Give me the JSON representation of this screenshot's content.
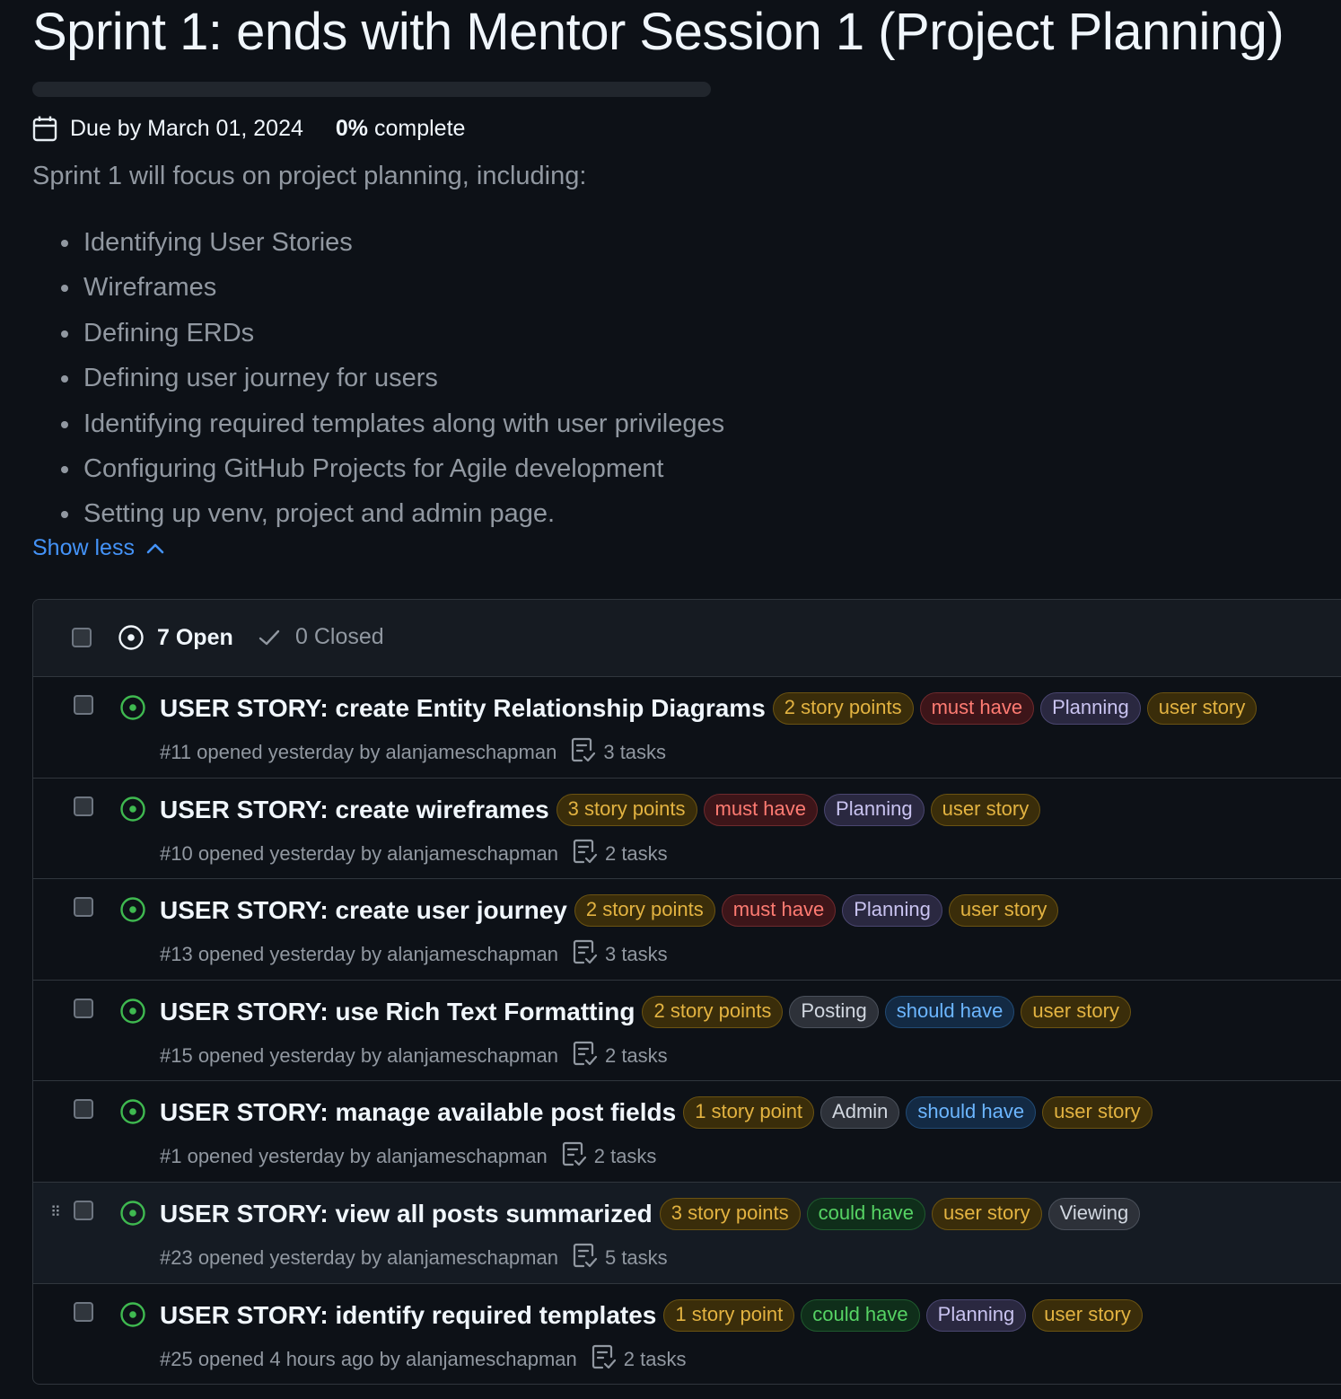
{
  "milestone": {
    "title": "Sprint 1: ends with Mentor Session 1 (Project Planning)",
    "progress_percent": 0,
    "due": "Due by March 01, 2024",
    "complete_value": "0%",
    "complete_label": "complete",
    "description": "Sprint 1 will focus on project planning, including:",
    "bullets": [
      "Identifying User Stories",
      "Wireframes",
      "Defining ERDs",
      "Defining user journey for users",
      "Identifying required templates along with user privileges",
      "Configuring GitHub Projects for Agile development",
      "Setting up venv, project and admin page."
    ],
    "show_less": "Show less"
  },
  "tabs": {
    "open": "7 Open",
    "closed": "0 Closed"
  },
  "label_colors": {
    "yellow": {
      "fg": "#e3b341",
      "bg": "#3a2d0a",
      "border": "#6b5312"
    },
    "red": {
      "fg": "#ff7b72",
      "bg": "#3d1519",
      "border": "#6e2a2d"
    },
    "purple": {
      "fg": "#c9c3f0",
      "bg": "#2a2840",
      "border": "#4a4670"
    },
    "gray": {
      "fg": "#d1d7e0",
      "bg": "#2d3139",
      "border": "#4a505a"
    },
    "blue": {
      "fg": "#6cb6ff",
      "bg": "#132a44",
      "border": "#214a74"
    },
    "green": {
      "fg": "#56d364",
      "bg": "#0f2e1a",
      "border": "#1f5a2e"
    }
  },
  "issues": [
    {
      "title": "USER STORY: create Entity Relationship Diagrams",
      "labels": [
        {
          "text": "2 story points",
          "color": "yellow"
        },
        {
          "text": "must have",
          "color": "red"
        },
        {
          "text": "Planning",
          "color": "purple"
        },
        {
          "text": "user story",
          "color": "yellow"
        }
      ],
      "meta": "#11 opened yesterday by alanjameschapman",
      "tasks": "3 tasks"
    },
    {
      "title": "USER STORY: create wireframes",
      "labels": [
        {
          "text": "3 story points",
          "color": "yellow"
        },
        {
          "text": "must have",
          "color": "red"
        },
        {
          "text": "Planning",
          "color": "purple"
        },
        {
          "text": "user story",
          "color": "yellow"
        }
      ],
      "meta": "#10 opened yesterday by alanjameschapman",
      "tasks": "2 tasks"
    },
    {
      "title": "USER STORY: create user journey",
      "labels": [
        {
          "text": "2 story points",
          "color": "yellow"
        },
        {
          "text": "must have",
          "color": "red"
        },
        {
          "text": "Planning",
          "color": "purple"
        },
        {
          "text": "user story",
          "color": "yellow"
        }
      ],
      "meta": "#13 opened yesterday by alanjameschapman",
      "tasks": "3 tasks"
    },
    {
      "title": "USER STORY: use Rich Text Formatting",
      "labels": [
        {
          "text": "2 story points",
          "color": "yellow"
        },
        {
          "text": "Posting",
          "color": "gray"
        },
        {
          "text": "should have",
          "color": "blue"
        },
        {
          "text": "user story",
          "color": "yellow"
        }
      ],
      "meta": "#15 opened yesterday by alanjameschapman",
      "tasks": "2 tasks"
    },
    {
      "title": "USER STORY: manage available post fields",
      "labels": [
        {
          "text": "1 story point",
          "color": "yellow"
        },
        {
          "text": "Admin",
          "color": "gray"
        },
        {
          "text": "should have",
          "color": "blue"
        },
        {
          "text": "user story",
          "color": "yellow"
        }
      ],
      "meta": "#1 opened yesterday by alanjameschapman",
      "tasks": "2 tasks"
    },
    {
      "title": "USER STORY: view all posts summarized",
      "labels": [
        {
          "text": "3 story points",
          "color": "yellow"
        },
        {
          "text": "could have",
          "color": "green"
        },
        {
          "text": "user story",
          "color": "yellow"
        },
        {
          "text": "Viewing",
          "color": "gray"
        }
      ],
      "meta": "#23 opened yesterday by alanjameschapman",
      "tasks": "5 tasks",
      "hovered": true
    },
    {
      "title": "USER STORY: identify required templates",
      "labels": [
        {
          "text": "1 story point",
          "color": "yellow"
        },
        {
          "text": "could have",
          "color": "green"
        },
        {
          "text": "Planning",
          "color": "purple"
        },
        {
          "text": "user story",
          "color": "yellow"
        }
      ],
      "meta": "#25 opened 4 hours ago by alanjameschapman",
      "tasks": "2 tasks"
    }
  ],
  "icons": {
    "calendar": "calendar-icon",
    "open_issue": "issue-opened-icon",
    "closed_check": "check-icon",
    "tasks": "tasklist-icon",
    "chevron_up": "chevron-up-icon",
    "drag": "grabber-icon"
  }
}
